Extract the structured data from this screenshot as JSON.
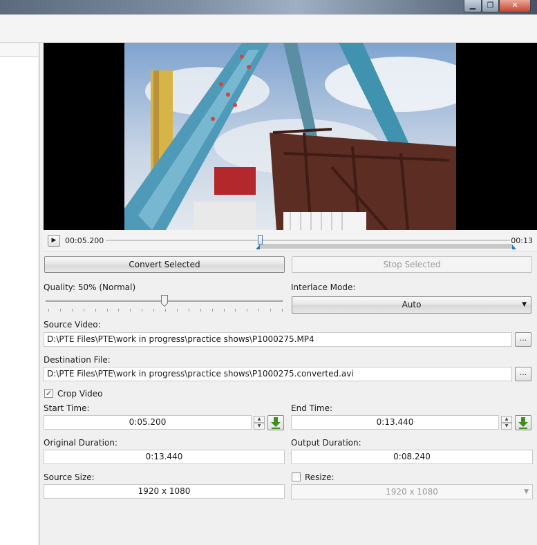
{
  "window": {
    "minimize_icon": "minimize-icon",
    "maximize_icon": "restore-icon",
    "close_icon": "close-icon",
    "close_glyph": "✕",
    "minimize_glyph": "▁",
    "maximize_glyph": "❐"
  },
  "player": {
    "play_icon": "play-icon",
    "play_glyph": "▶",
    "current_time": "00:05.200",
    "end_time": "00:13",
    "position_fraction": 0.4,
    "range_start_fraction": 0.4,
    "range_end_fraction": 1.0
  },
  "actions": {
    "convert_label": "Convert Selected",
    "stop_label": "Stop Selected"
  },
  "quality": {
    "label": "Quality: 50% (Normal)",
    "value_percent": 50
  },
  "interlace": {
    "label": "Interlace Mode:",
    "value": "Auto",
    "arrow_glyph": "▼"
  },
  "source_video": {
    "label": "Source Video:",
    "value": "D:\\PTE Files\\PTE\\work in progress\\practice shows\\P1000275.MP4",
    "browse_label": "..."
  },
  "destination": {
    "label": "Destination File:",
    "value": "D:\\PTE Files\\PTE\\work in progress\\practice shows\\P1000275.converted.avi",
    "browse_label": "..."
  },
  "crop": {
    "label": "Crop Video",
    "checked": true,
    "check_glyph": "✓"
  },
  "start_time": {
    "label": "Start Time:",
    "value": "0:05.200"
  },
  "end_time": {
    "label": "End Time:",
    "value": "0:13.440"
  },
  "spin_glyphs": {
    "up": "▲",
    "down": "▼"
  },
  "original_duration": {
    "label": "Original Duration:",
    "value": "0:13.440"
  },
  "output_duration": {
    "label": "Output Duration:",
    "value": "0:08.240"
  },
  "source_size": {
    "label": "Source Size:",
    "value": "1920 x 1080"
  },
  "resize": {
    "label": "Resize:",
    "checked": false,
    "value": "1920 x 1080",
    "arrow_glyph": "▼"
  },
  "colors": {
    "accent_blue": "#2b79c2",
    "grab_green": "#3f8f1f"
  }
}
